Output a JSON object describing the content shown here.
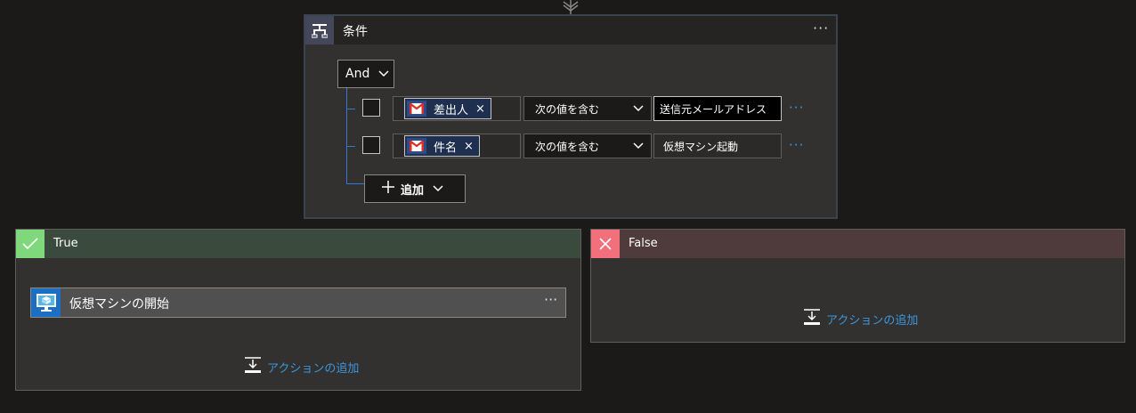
{
  "condition": {
    "title": "条件",
    "more": "···",
    "group_operator": "And",
    "rows": [
      {
        "token": "差出人",
        "operator": "次の値を含む",
        "value": "送信元メールアドレス"
      },
      {
        "token": "件名",
        "operator": "次の値を含む",
        "value": "仮想マシン起動"
      }
    ],
    "token_remove": "×",
    "row_more": "···",
    "add_label": "追加"
  },
  "true_branch": {
    "label": "True",
    "action_title": "仮想マシンの開始",
    "action_more": "···",
    "add_action": "アクションの追加"
  },
  "false_branch": {
    "label": "False",
    "add_action": "アクションの追加"
  },
  "colors": {
    "background": "#1b1a19",
    "card": "#323130",
    "true_accent": "#7fd87c",
    "false_accent": "#f1707b",
    "link": "#3a96dd",
    "connector": "#2e79d6"
  },
  "icons": [
    "flow-connector-icon",
    "condition-icon",
    "gmail-icon",
    "chevron-down-icon",
    "plus-icon",
    "checkmark-icon",
    "close-icon",
    "virtual-machine-icon",
    "add-action-icon"
  ]
}
